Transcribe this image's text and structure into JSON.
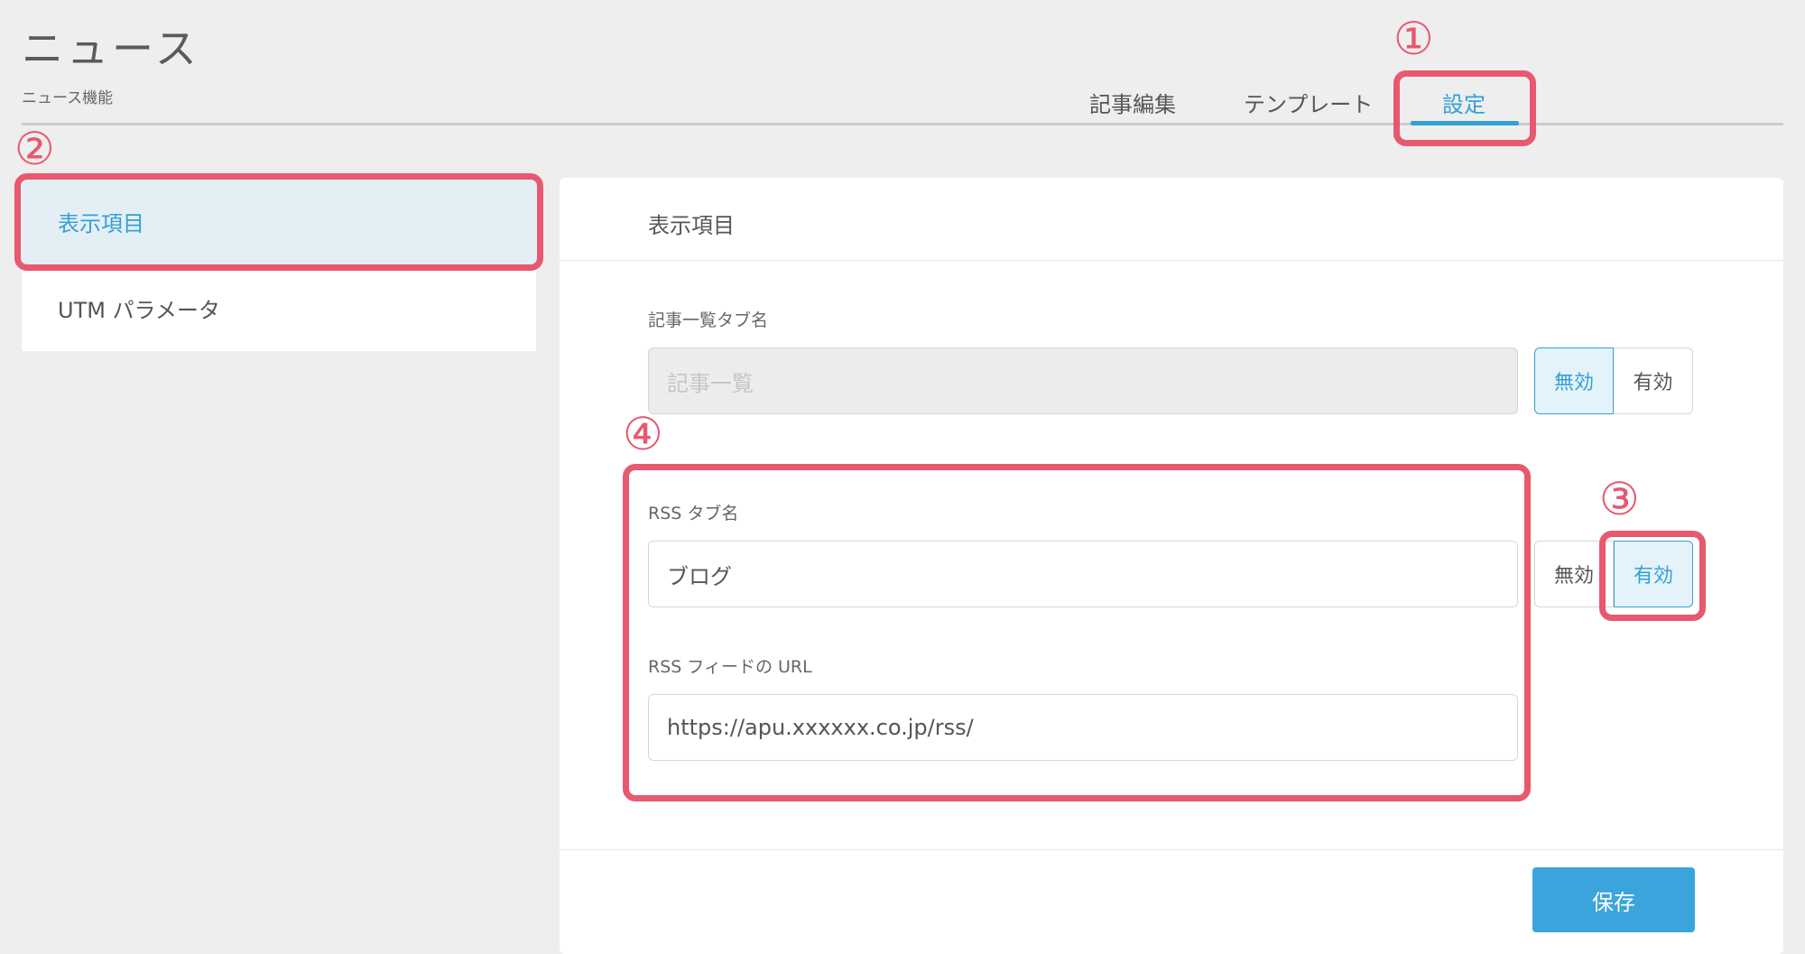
{
  "header": {
    "title": "ニュース",
    "subtitle": "ニュース機能"
  },
  "tabs": [
    {
      "label": "記事編集",
      "active": false
    },
    {
      "label": "テンプレート",
      "active": false
    },
    {
      "label": "設定",
      "active": true
    }
  ],
  "sidebar": {
    "items": [
      {
        "label": "表示項目",
        "active": true
      },
      {
        "label": "UTM パラメータ",
        "active": false
      }
    ]
  },
  "panel": {
    "title": "表示項目",
    "fields": [
      {
        "label": "記事一覧タブ名",
        "value": "記事一覧",
        "disabled": true,
        "toggle": {
          "off_label": "無効",
          "on_label": "有効",
          "state": "無効"
        }
      },
      {
        "label": "RSS タブ名",
        "value": "ブログ",
        "disabled": false,
        "toggle": {
          "off_label": "無効",
          "on_label": "有効",
          "state": "有効"
        }
      },
      {
        "label": "RSS フィードの URL",
        "value": "https://apu.xxxxxx.co.jp/rss/",
        "disabled": false
      }
    ],
    "save_label": "保存"
  },
  "annotations": [
    "①",
    "②",
    "③",
    "④"
  ],
  "colors": {
    "accent": "#33a0d5",
    "save_button": "#3ba4dc",
    "callout": "#e8586e",
    "background": "#eeeeee"
  }
}
